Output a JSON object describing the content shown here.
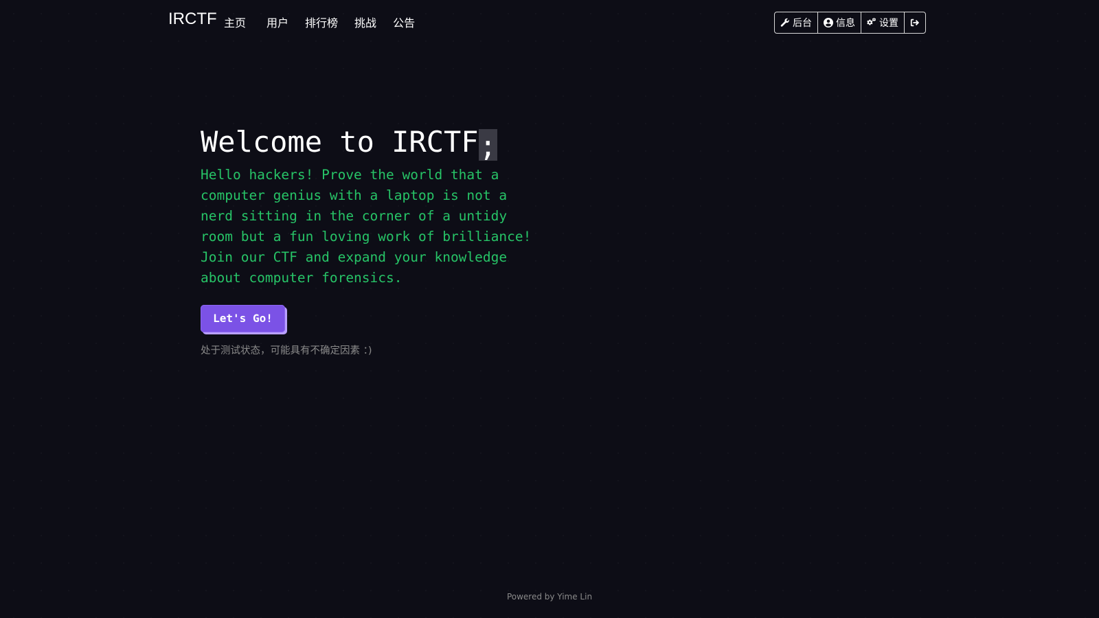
{
  "navbar": {
    "brand": "IRCTF",
    "links": [
      {
        "label": "主页"
      },
      {
        "label": "用户"
      },
      {
        "label": "排行榜"
      },
      {
        "label": "挑战"
      },
      {
        "label": "公告"
      }
    ],
    "actions": {
      "admin": {
        "label": "后台",
        "icon": "wrench-icon"
      },
      "profile": {
        "label": "信息",
        "icon": "user-circle-icon"
      },
      "settings": {
        "label": "设置",
        "icon": "cogs-icon"
      },
      "logout": {
        "icon": "sign-out-icon"
      }
    }
  },
  "hero": {
    "title": "Welcome to IRCTF",
    "cursor": ";",
    "description": "Hello hackers! Prove the world that a computer genius with a laptop is not a nerd sitting in the corner of a untidy room but a fun loving work of brilliance! Join our CTF and expand your knowledge about computer forensics.",
    "button_label": "Let's Go!",
    "notice": "处于测试状态，可能具有不确定因素 ：)"
  },
  "footer": {
    "text": "Powered by Yime Lin"
  },
  "colors": {
    "background": "#0d0d16",
    "accent_green": "#27c467",
    "button_purple": "#7b52e6"
  }
}
